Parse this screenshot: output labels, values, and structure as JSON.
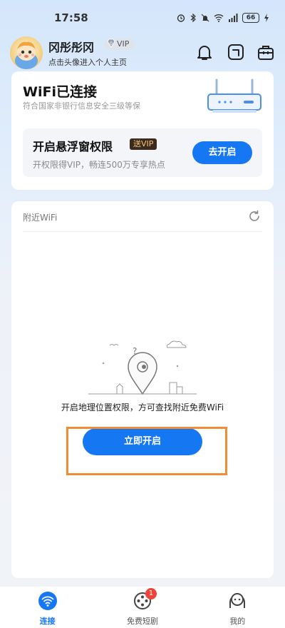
{
  "status_bar": {
    "time": "17:58",
    "battery": "66"
  },
  "header": {
    "user_name": "冈彤彤冈",
    "vip_label": "VIP",
    "user_hint": "点击头像进入个人主页"
  },
  "wifi_card": {
    "title": "WiFi已连接",
    "description": "符合国家非银行信息安全三级等保",
    "float_title": "开启悬浮窗权限",
    "gift_vip": "送VIP",
    "float_desc": "开权限得VIP，畅连500万专享热点",
    "go_open_label": "去开启"
  },
  "nearby": {
    "title": "附近WiFi",
    "location_hint": "开启地理位置权限，方可查找附近免费WiFi",
    "open_now_label": "立即开启"
  },
  "bottom_nav": {
    "items": [
      {
        "label": "连接",
        "icon": "wifi-icon",
        "active": true
      },
      {
        "label": "免费短剧",
        "icon": "film-reel-icon",
        "badge": "1"
      },
      {
        "label": "我的",
        "icon": "profile-icon"
      }
    ]
  },
  "colors": {
    "accent": "#1677f2",
    "highlight": "#f08d35",
    "badge": "#f0443a"
  }
}
